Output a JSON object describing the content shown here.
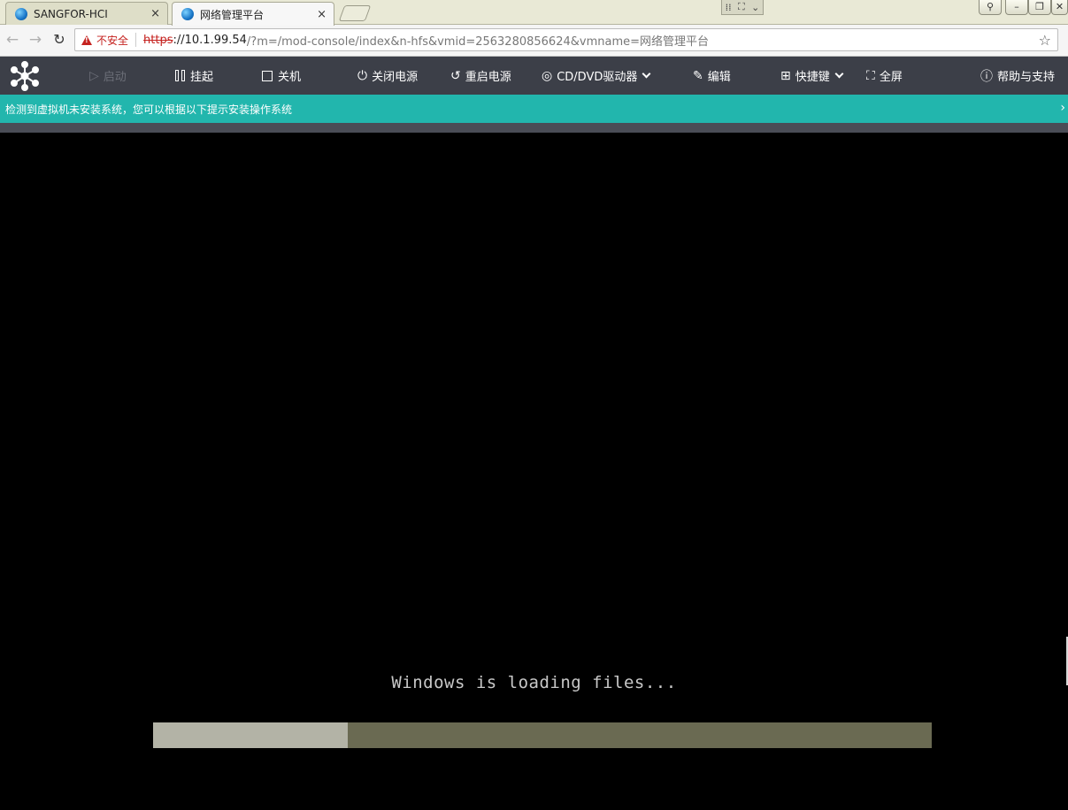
{
  "browser": {
    "tabs": [
      {
        "title": "SANGFOR-HCI",
        "close": "×"
      },
      {
        "title": "网络管理平台",
        "close": "×"
      }
    ],
    "security_label": "不安全",
    "url_scheme": "https",
    "url_host": "://10.1.99.54",
    "url_rest": "/?m=/mod-console/index&n-hfs&vmid=2563280856624&vmname=网络管理平台"
  },
  "toolbar": {
    "start": "启动",
    "suspend": "挂起",
    "shutdown": "关机",
    "power_off": "关闭电源",
    "restart": "重启电源",
    "cdrom": "CD/DVD驱动器",
    "edit": "编辑",
    "hotkeys": "快捷键",
    "fullscreen": "全屏",
    "help": "帮助与支持"
  },
  "notice": {
    "text": "检测到虚拟机未安装系统，您可以根据以下提示安装操作系统"
  },
  "console": {
    "loading_text": "Windows is loading files...",
    "progress": 0.25
  },
  "colors": {
    "toolbar_bg": "#3c3f48",
    "notice_bg": "#22b6ad",
    "progress_track": "#6a6a52",
    "progress_fill": "#b3b3a6"
  }
}
